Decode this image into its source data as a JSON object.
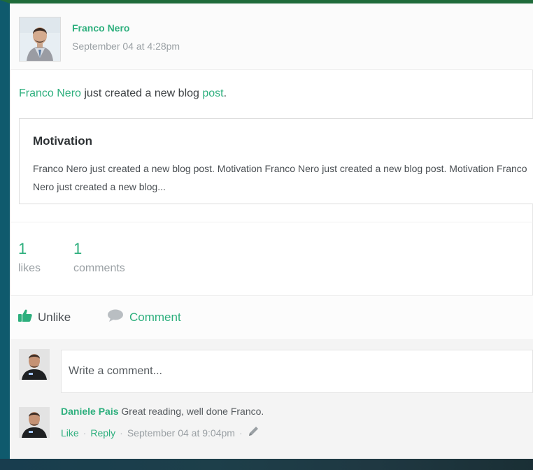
{
  "post": {
    "author": "Franco Nero",
    "timestamp": "September 04 at 4:28pm",
    "activity": {
      "actor": "Franco Nero",
      "middle": " just created a new blog ",
      "object": "post",
      "end": "."
    },
    "blog": {
      "title": "Motivation",
      "excerpt": "Franco Nero just created a new blog post. Motivation Franco Nero just created a new blog post. Motivation Franco Nero just created a new blog..."
    }
  },
  "stats": {
    "likes": {
      "count": "1",
      "label": "likes"
    },
    "comments": {
      "count": "1",
      "label": "comments"
    }
  },
  "actions": {
    "unlike_label": "Unlike",
    "comment_label": "Comment"
  },
  "comment_form": {
    "placeholder": "Write a comment..."
  },
  "comments": [
    {
      "author": "Daniele Pais",
      "text": "Great reading, well done Franco.",
      "like_label": "Like",
      "reply_label": "Reply",
      "timestamp": "September 04 at 9:04pm"
    }
  ],
  "colors": {
    "accent": "#2daf7d",
    "text": "#3b3f42",
    "muted": "#9aa0a4",
    "frame": "#0f5a6d"
  },
  "icons": {
    "like": "thumbs-up-icon",
    "comment": "speech-bubble-icon",
    "edit": "pencil-icon"
  }
}
